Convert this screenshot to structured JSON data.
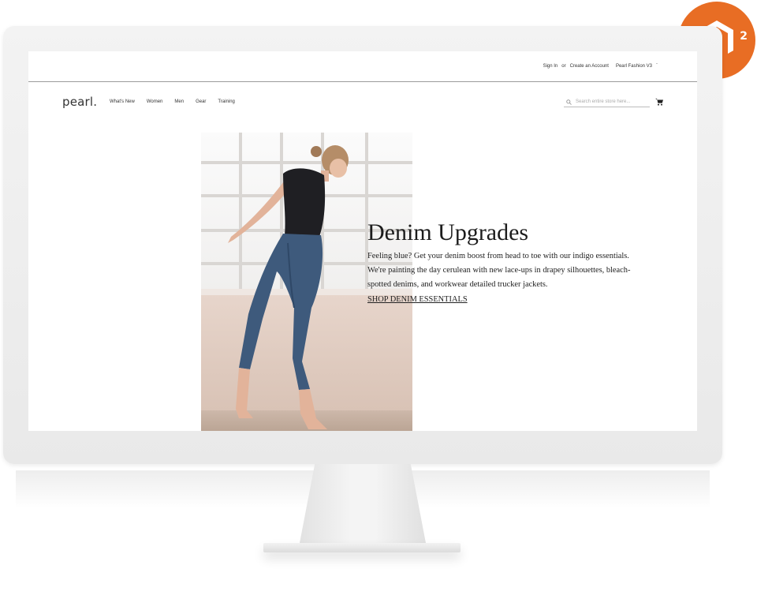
{
  "badge": {
    "version": "2",
    "brand_icon": "magento-icon"
  },
  "header": {
    "sign_in": "Sign In",
    "or": "or",
    "create_account": "Create an Account",
    "store_switcher": "Pearl Fashion V3",
    "switcher_caret": "ˇ"
  },
  "nav": {
    "logo": "pearl.",
    "items": [
      "What's New",
      "Women",
      "Men",
      "Gear",
      "Training"
    ]
  },
  "search": {
    "placeholder": "Search entire store here..."
  },
  "hero": {
    "title": "Denim Upgrades",
    "text": "Feeling blue? Get your denim boost from head to toe with our indigo essentials. We're painting the day cerulean with new lace-ups in drapey silhouettes, bleach-spotted denims, and workwear detailed trucker jackets.",
    "link": "SHOP DENIM ESSENTIALS"
  },
  "colors": {
    "badge": "#e86d24",
    "text": "#222222",
    "rule": "#9b9b9b"
  }
}
